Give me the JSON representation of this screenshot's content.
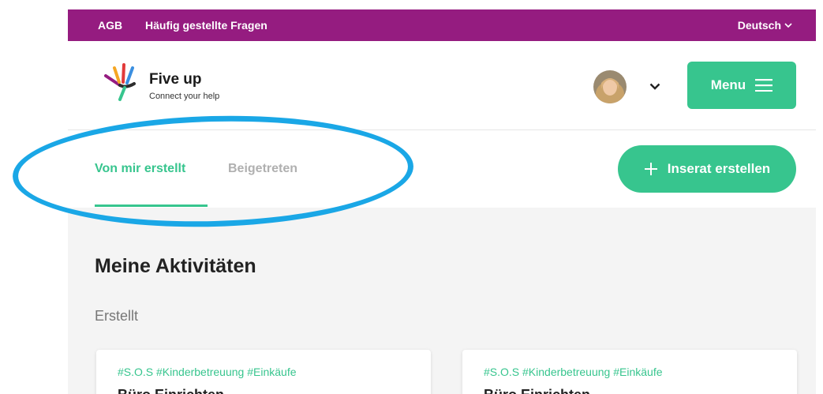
{
  "topbar": {
    "links": [
      "AGB",
      "Häufig gestellte Fragen"
    ],
    "language": "Deutsch"
  },
  "brand": {
    "name": "Five up",
    "tagline": "Connect your help"
  },
  "header": {
    "menu_label": "Menu"
  },
  "tabs": [
    {
      "label": "Von mir erstellt",
      "active": true
    },
    {
      "label": "Beigetreten",
      "active": false
    }
  ],
  "create_button_label": "Inserat erstellen",
  "main": {
    "title": "Meine Aktivitäten",
    "section_label": "Erstellt",
    "cards": [
      {
        "tags": "#S.O.S #Kinderbetreuung #Einkäufe",
        "title": "Büro Einrichten"
      },
      {
        "tags": "#S.O.S #Kinderbetreuung #Einkäufe",
        "title": "Büro Einrichten"
      }
    ]
  },
  "colors": {
    "topbar": "#951c80",
    "accent": "#37c58e",
    "highlight": "#1aa7e6"
  }
}
